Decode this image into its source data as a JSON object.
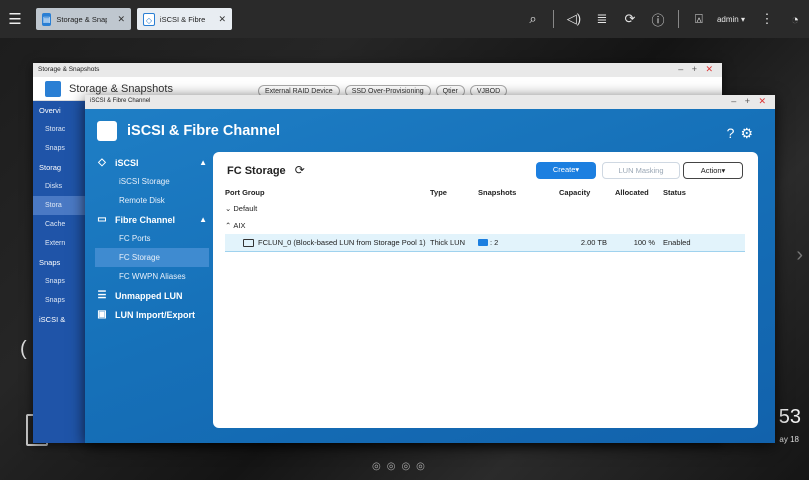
{
  "taskbar": {
    "tabs": [
      {
        "label": "Storage & Snapshots"
      },
      {
        "label": "iSCSI & Fibre ..."
      }
    ],
    "user": "admin",
    "icons": [
      "menu-icon",
      "search-icon",
      "volume-icon",
      "stack-icon",
      "sync-icon",
      "info-icon",
      "user-icon",
      "more-icon",
      "dashboard-icon"
    ]
  },
  "desktop": {
    "clock": "53",
    "date": "ay 18"
  },
  "back_window": {
    "window_title": "Storage & Snapshots",
    "title": "Storage & Snapshots",
    "pills": [
      "External RAID Device",
      "SSD Over-Provisioning",
      "Qtier",
      "VJBOD"
    ],
    "sidebar": [
      "Overvi",
      "Storac",
      "Snaps",
      "Storag",
      "Disks",
      "Stora",
      "Cache",
      "Extern",
      "Snaps",
      "Snaps",
      "Snaps",
      "iSCSI &"
    ]
  },
  "front_window": {
    "window_title": "iSCSI & Fibre Channel",
    "title": "iSCSI & Fibre Channel",
    "nav": {
      "iscsi": "iSCSI",
      "iscsi_storage": "iSCSI Storage",
      "remote_disk": "Remote Disk",
      "fibre_channel": "Fibre Channel",
      "fc_ports": "FC Ports",
      "fc_storage": "FC Storage",
      "fc_wwpn": "FC WWPN Aliases",
      "unmapped": "Unmapped LUN",
      "lun_import": "LUN Import/Export"
    },
    "panel": {
      "heading": "FC Storage",
      "create_label": "Create▾",
      "lun_masking_label": "LUN Masking",
      "action_label": "Action▾",
      "columns": [
        "Port Group",
        "Type",
        "Snapshots",
        "Capacity",
        "Allocated",
        "Status"
      ],
      "groups": [
        {
          "name": "Default"
        },
        {
          "name": "AIX"
        }
      ],
      "row": {
        "name": "FCLUN_0 (Block-based LUN from Storage Pool 1)",
        "type": "Thick LUN",
        "snapshots": ": 2",
        "capacity": "2.00 TB",
        "allocated": "100 %",
        "status": "Enabled"
      }
    }
  },
  "colors": {
    "accent": "#1c7fe0",
    "window_bg": "#1671b9",
    "selected_row": "#e2f3fb"
  }
}
